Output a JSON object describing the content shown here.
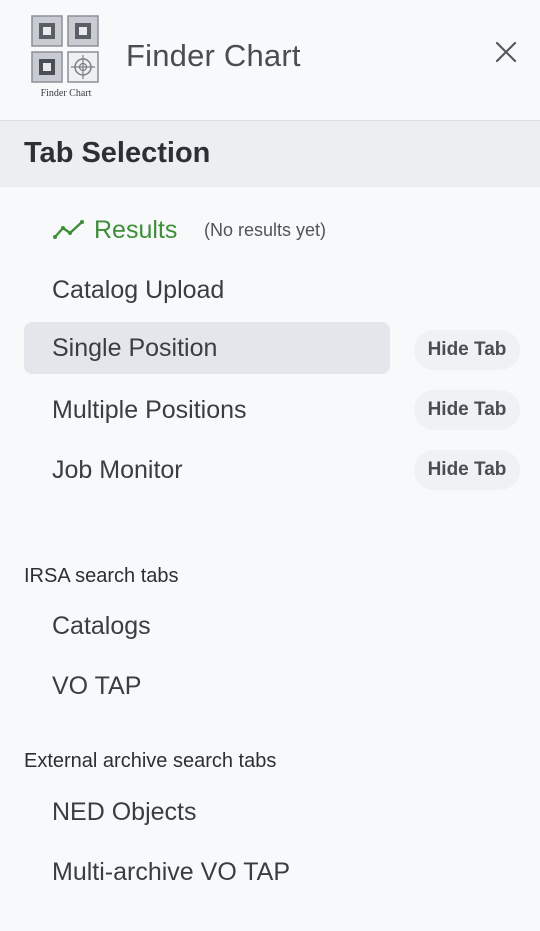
{
  "header": {
    "app_title": "Finder Chart",
    "logo_text": "Finder Chart"
  },
  "tab_selection": {
    "title": "Tab Selection",
    "results": {
      "label": "Results",
      "note": "(No results yet)",
      "color": "#3e8e3a"
    },
    "items": [
      {
        "label": "Catalog Upload"
      },
      {
        "label": "Single Position",
        "selected": true,
        "hide_label": "Hide Tab"
      },
      {
        "label": "Multiple Positions",
        "hide_label": "Hide Tab"
      },
      {
        "label": "Job Monitor",
        "hide_label": "Hide Tab"
      }
    ]
  },
  "irsa": {
    "heading": "IRSA search tabs",
    "items": [
      {
        "label": "Catalogs"
      },
      {
        "label": "VO TAP"
      }
    ]
  },
  "external": {
    "heading": "External archive search tabs",
    "items": [
      {
        "label": "NED Objects"
      },
      {
        "label": "Multi-archive VO TAP"
      }
    ]
  }
}
